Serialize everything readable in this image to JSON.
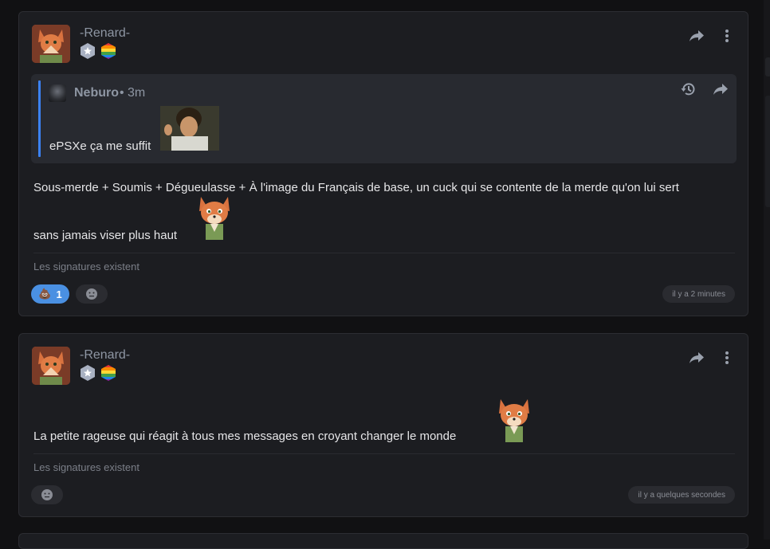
{
  "posts": [
    {
      "username": "-Renard-",
      "quote": {
        "author": "Neburo",
        "separator": "•",
        "time": "3m",
        "text": "ePSXe ça me suffit"
      },
      "content_line1": "Sous-merde + Soumis + Dégueulasse + À l'image du Français de base, un cuck qui se contente de la merde qu'on lui sert",
      "content_line2": "sans jamais viser plus haut",
      "signature": "Les signatures existent",
      "reaction_count": "1",
      "reaction_emoji": "💩",
      "timestamp": "il y a 2 minutes"
    },
    {
      "username": "-Renard-",
      "content_line1": "La petite rageuse qui réagit à tous mes messages en croyant changer le monde",
      "signature": "Les signatures existent",
      "timestamp": "il y a quelques secondes"
    }
  ],
  "icons": {
    "share": "share-arrow-icon",
    "more": "more-vertical-icon",
    "history": "history-icon",
    "add_reaction": "add-reaction-icon"
  },
  "colors": {
    "background": "#111113",
    "card": "#1c1d21",
    "quote_bg": "#282a30",
    "accent": "#3b82f6",
    "reaction_active": "#4a90e2",
    "muted_text": "#8e96a3"
  }
}
